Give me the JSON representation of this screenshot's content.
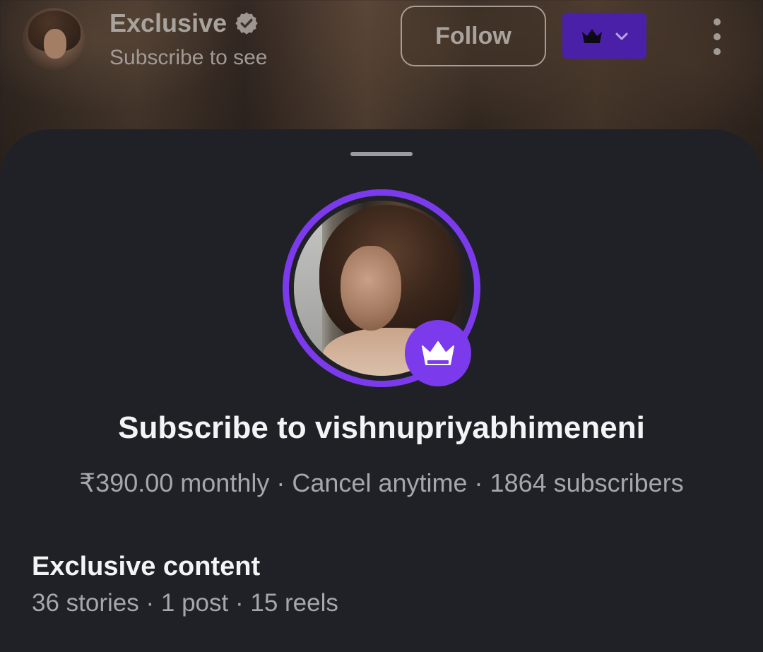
{
  "header": {
    "title": "Exclusive",
    "subtitle": "Subscribe to see",
    "follow_label": "Follow"
  },
  "sheet": {
    "title": "Subscribe to vishnupriyabhimeneni",
    "price": "₹390.00 monthly",
    "cancel": "Cancel anytime",
    "subscribers": "1864 subscribers",
    "separator": "·"
  },
  "exclusive": {
    "title": "Exclusive content",
    "stories": "36 stories",
    "posts": "1 post",
    "reels": "15 reels"
  },
  "colors": {
    "accent": "#7c3aed",
    "crown_button": "#4b20a8",
    "sheet_bg": "#202126",
    "text_primary": "#f4f4f6",
    "text_secondary": "#a5a7ad"
  },
  "icons": {
    "verified": "verified-badge-icon",
    "crown": "crown-icon",
    "chevron": "chevron-down-icon",
    "more": "more-vertical-icon"
  }
}
